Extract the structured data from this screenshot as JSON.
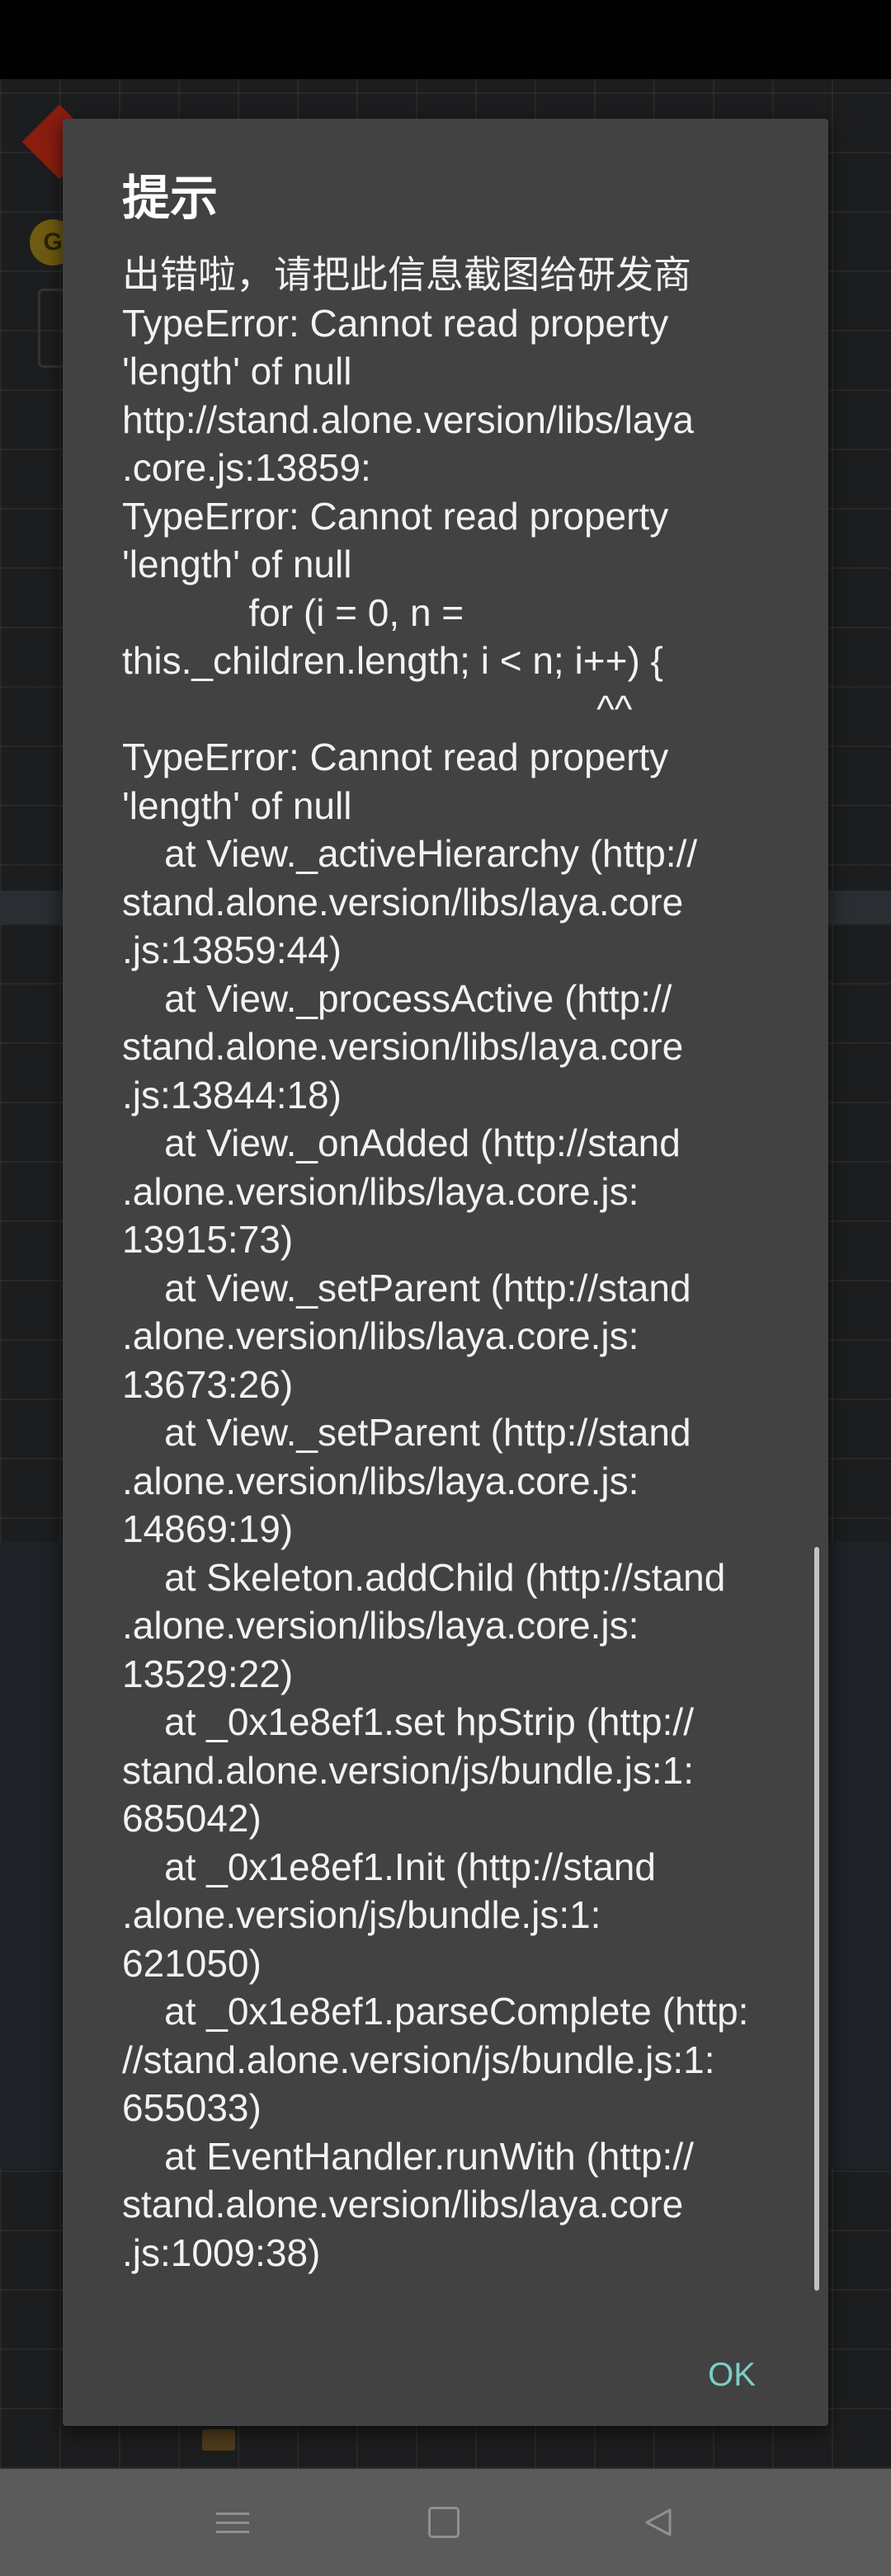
{
  "dialog": {
    "title": "提示",
    "message": "出错啦，请把此信息截图给研发商\nTypeError: Cannot read property\n'length' of null\nhttp://stand.alone.version/libs/laya\n.core.js:13859:\nTypeError: Cannot read property\n'length' of null\n            for (i = 0, n =\nthis._children.length; i < n; i++) {\n                                             ^^\nTypeError: Cannot read property\n'length' of null\n    at View._activeHierarchy (http://\nstand.alone.version/libs/laya.core\n.js:13859:44)\n    at View._processActive (http://\nstand.alone.version/libs/laya.core\n.js:13844:18)\n    at View._onAdded (http://stand\n.alone.version/libs/laya.core.js:\n13915:73)\n    at View._setParent (http://stand\n.alone.version/libs/laya.core.js:\n13673:26)\n    at View._setParent (http://stand\n.alone.version/libs/laya.core.js:\n14869:19)\n    at Skeleton.addChild (http://stand\n.alone.version/libs/laya.core.js:\n13529:22)\n    at _0x1e8ef1.set hpStrip (http://\nstand.alone.version/js/bundle.js:1:\n685042)\n    at _0x1e8ef1.Init (http://stand\n.alone.version/js/bundle.js:1:\n621050)\n    at _0x1e8ef1.parseComplete (http:\n//stand.alone.version/js/bundle.js:1:\n655033)\n    at EventHandler.runWith (http://\nstand.alone.version/libs/laya.core\n.js:1009:38)",
    "ok_label": "OK"
  },
  "background": {
    "coin_letter": "G"
  },
  "nav_bar": {
    "menu_icon": "menu-icon",
    "home_icon": "home-icon",
    "back_icon": "back-icon"
  },
  "colors": {
    "dialog_bg": "#424242",
    "accent": "#7ccfc8",
    "nav_bg": "#5b5b5b"
  }
}
